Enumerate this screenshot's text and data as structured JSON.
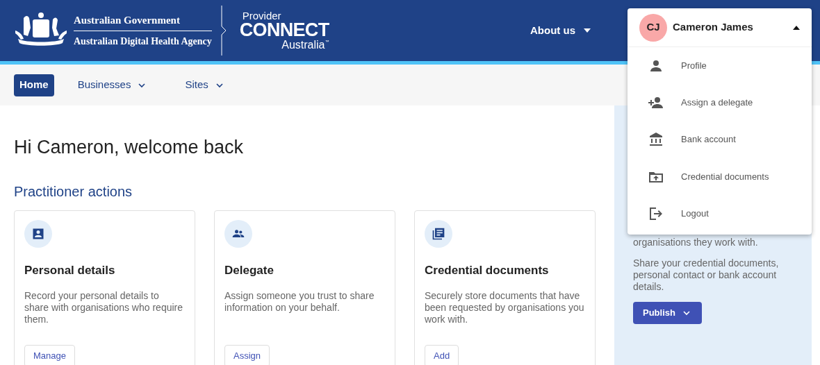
{
  "header": {
    "gov_name": "Australian Government",
    "agency": "Australian Digital Health Agency",
    "product_top": "Provider",
    "product_main": "CONNECT",
    "product_bottom": "Australia",
    "trademark": "™",
    "about": "About us"
  },
  "user_menu": {
    "initials": "CJ",
    "name": "Cameron James",
    "expanded": true,
    "items": [
      {
        "label": "Profile",
        "kind": "profile"
      },
      {
        "label": "Assign a delegate",
        "kind": "delegate"
      },
      {
        "label": "Bank account",
        "kind": "bank"
      },
      {
        "label": "Credential documents",
        "kind": "documents"
      },
      {
        "label": "Logout",
        "kind": "logout"
      }
    ]
  },
  "nav": [
    {
      "label": "Home",
      "selected": true,
      "dropdown": false
    },
    {
      "label": "Businesses",
      "selected": false,
      "dropdown": true
    },
    {
      "label": "Sites",
      "selected": false,
      "dropdown": true
    }
  ],
  "greeting": "Hi Cameron, welcome back",
  "section_title": "Practitioner actions",
  "cards": [
    {
      "kind": "personal",
      "title": "Personal details",
      "text": "Record your personal details to share with organisations who require them.",
      "button": "Manage"
    },
    {
      "kind": "delegate",
      "title": "Delegate",
      "text": "Assign someone you trust to share information on your behalf.",
      "button": "Assign"
    },
    {
      "kind": "documents",
      "title": "Credential documents",
      "text": "Securely store documents that have been requested by organisations you work with.",
      "button": "Add"
    }
  ],
  "side_panel": {
    "paragraphs": [
      "organisations they work with.",
      "Share your credential documents, personal contact or bank account details."
    ],
    "button": "Publish"
  }
}
